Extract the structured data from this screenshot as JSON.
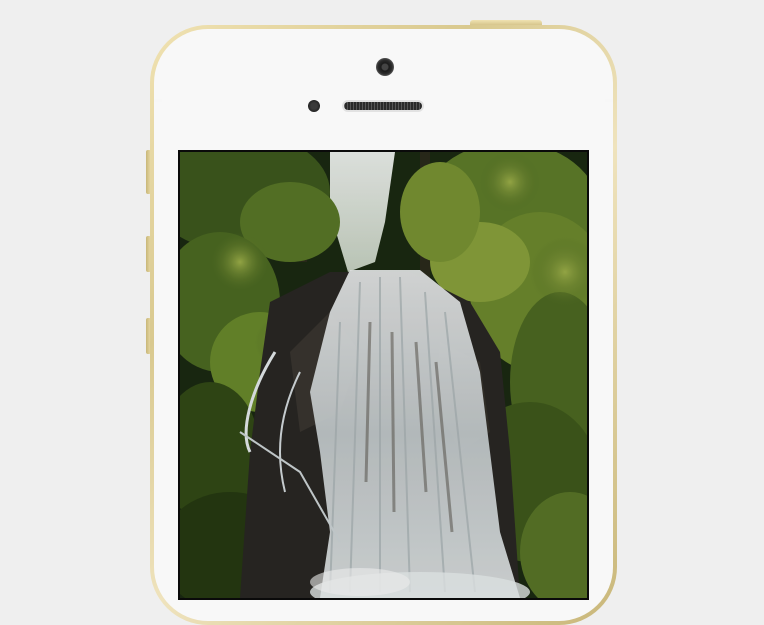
{
  "device": {
    "model": "iPhone",
    "finish_color": "#e0cf94",
    "face_color": "#f8f8f8"
  },
  "screen": {
    "content": "video",
    "colors": {
      "foliage_dark": "#1b2a12",
      "foliage_mid": "#4a6a24",
      "foliage_light": "#8fa53f",
      "rock": "#2a2824",
      "water": "#e8eef0",
      "sky": "#dfe6e2"
    }
  },
  "page": {
    "background_color": "#efefef"
  }
}
